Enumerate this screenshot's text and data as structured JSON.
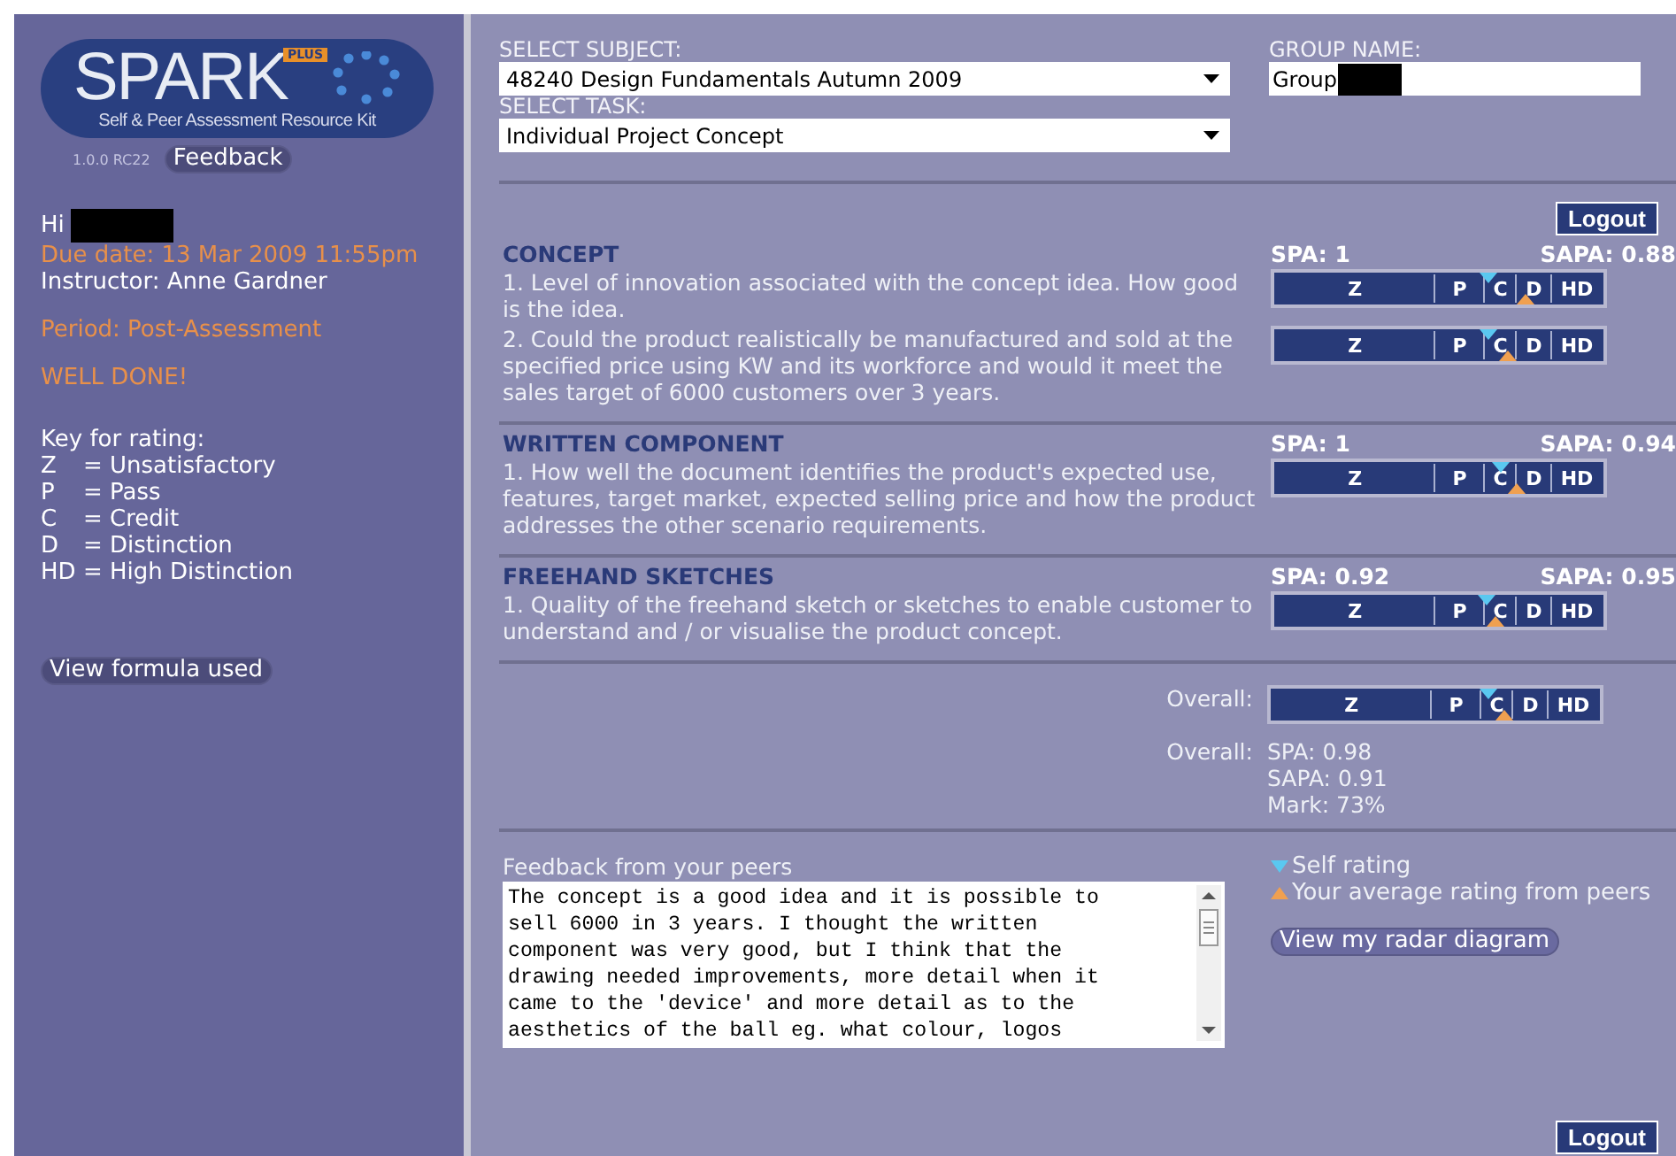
{
  "logo": {
    "title": "SPARK",
    "badge": "PLUS",
    "subtitle": "Self & Peer Assessment Resource Kit"
  },
  "version": "1.0.0 RC22",
  "feedback_button": "Feedback",
  "greeting": {
    "text": "Hi",
    "redacted": true
  },
  "due_date": "Due date: 13 Mar 2009 11:55pm",
  "instructor": "Instructor: Anne Gardner",
  "period": "Period: Post-Assessment",
  "message": "WELL DONE!",
  "key": {
    "title": "Key for rating:",
    "items": [
      {
        "code": "Z",
        "meaning": "= Unsatisfactory"
      },
      {
        "code": "P",
        "meaning": "= Pass"
      },
      {
        "code": "C",
        "meaning": "= Credit"
      },
      {
        "code": "D",
        "meaning": "= Distinction"
      },
      {
        "code": "HD",
        "meaning": "= High Distinction"
      }
    ]
  },
  "formula_button": "View formula used",
  "subject": {
    "label": "SELECT SUBJECT:",
    "value": "48240 Design Fundamentals Autumn 2009"
  },
  "task": {
    "label": "SELECT TASK:",
    "value": "Individual Project Concept"
  },
  "group": {
    "label": "GROUP NAME:",
    "value": "Group",
    "redacted": true
  },
  "logout_top": "Logout",
  "criteria": [
    {
      "title": "CONCEPT",
      "spa": "SPA: 1",
      "sapa": "SAPA: 0.88",
      "questions": [
        {
          "text": "1. Level of innovation associated with the concept idea. How good is the idea.",
          "rating": {
            "segments": [
              "Z",
              "P",
              "C",
              "D",
              "HD"
            ],
            "self_marker": {
              "level": 0.65
            },
            "peer_marker": {
              "level": 0.765
            }
          }
        },
        {
          "text": "2. Could the product realistically be manufactured and sold at the specified price using KW and its workforce and would it meet the sales target of 6000 customers over 3 years.",
          "rating": {
            "segments": [
              "Z",
              "P",
              "C",
              "D",
              "HD"
            ],
            "self_marker": {
              "level": 0.65
            },
            "peer_marker": {
              "level": 0.71
            }
          }
        }
      ]
    },
    {
      "title": "WRITTEN COMPONENT",
      "spa": "SPA: 1",
      "sapa": "SAPA: 0.94",
      "questions": [
        {
          "text": "1. How well the document identifies the product's expected use, features, target market, expected selling price and how the product addresses the other scenario requirements.",
          "rating": {
            "segments": [
              "Z",
              "P",
              "C",
              "D",
              "HD"
            ],
            "self_marker": {
              "level": 0.69
            },
            "peer_marker": {
              "level": 0.735
            }
          }
        }
      ]
    },
    {
      "title": "FREEHAND SKETCHES",
      "spa": "SPA: 0.92",
      "sapa": "SAPA: 0.95",
      "questions": [
        {
          "text": "1. Quality of the freehand sketch or sketches to enable customer to understand and / or visualise the product concept.",
          "rating": {
            "segments": [
              "Z",
              "P",
              "C",
              "D",
              "HD"
            ],
            "self_marker": {
              "level": 0.645
            },
            "peer_marker": {
              "level": 0.67
            }
          }
        }
      ]
    }
  ],
  "overall": {
    "label": "Overall:",
    "rating": {
      "segments": [
        "Z",
        "P",
        "C",
        "D",
        "HD"
      ],
      "self_marker": {
        "level": 0.66
      },
      "peer_marker": {
        "level": 0.71
      }
    },
    "summary_label": "Overall:",
    "summary": [
      "SPA: 0.98",
      "SAPA: 0.91",
      "Mark: 73%"
    ]
  },
  "feedback": {
    "label": "Feedback from your peers",
    "lines": [
      "The concept is a good idea and it is possible to",
      "sell 6000 in 3 years. I thought the written",
      "component was very good, but I think that the",
      "drawing needed improvements, more detail when it",
      "came to the 'device' and more detail as to the",
      "aesthetics of the ball eg. what colour, logos"
    ]
  },
  "legend": [
    {
      "kind": "self",
      "text": "Self rating"
    },
    {
      "kind": "peer",
      "text": "Your average rating from peers"
    }
  ],
  "radar_button": "View my radar diagram",
  "logout_bottom": "Logout"
}
